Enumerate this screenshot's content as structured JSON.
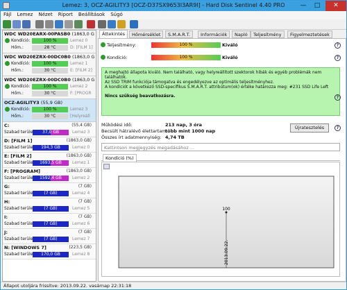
{
  "window": {
    "title": "Lemez: 3, OCZ-AGILITY3 [OCZ-D37SX9653I3AR9I] - Hard Disk Sentinel 4.40 PRO"
  },
  "menu": [
    "Fájl",
    "Lemez",
    "Nézet",
    "Riport",
    "Beállítások",
    "Súgó"
  ],
  "disks": [
    {
      "name": "WDC WD20EARX-00PASB0",
      "size": "(1863,0 GB)",
      "cond_label": "Kondíció:",
      "cond": "100 %",
      "cond_ext": "Lemez 0",
      "temp_label": "Hőm.:",
      "temp": "28 °C",
      "temp_ext": "D: [FILM 1]",
      "selected": false
    },
    {
      "name": "WDC WD20EZRX-00DC0B0",
      "size": "(1863,0 GB)",
      "cond_label": "Kondíció:",
      "cond": "100 %",
      "cond_ext": "Lemez 1",
      "temp_label": "Hőm.:",
      "temp": "30 °C",
      "temp_ext": "E: [FILM 2]",
      "selected": false
    },
    {
      "name": "WDC WD20EZRX-00DC0B0",
      "size": "(1863,0 GB)",
      "cond_label": "Kondíció:",
      "cond": "100 %",
      "cond_ext": "Lemez 2",
      "temp_label": "Hőm.:",
      "temp": "30 °C",
      "temp_ext": "F: [PROGR",
      "selected": false
    },
    {
      "name": "OCZ-AGILITY3",
      "size": "(55,9 GB)",
      "cond_label": "Kondíció:",
      "cond": "100 %",
      "cond_ext": "Lemez 3",
      "temp_label": "Hőm.:",
      "temp": "30 °C",
      "temp_ext": "[Helyreáll",
      "selected": true
    }
  ],
  "partitions": [
    {
      "name": "C:",
      "size": "(55,4 GB)",
      "free_label": "Szabad terület",
      "free": "37,0 GB",
      "disk": "Lemez 3",
      "mag": true
    },
    {
      "name": "D: [FILM 1]",
      "size": "(1863,0 GB)",
      "free_label": "Szabad terület",
      "free": "194,3 GB",
      "disk": "Lemez 0",
      "mag": false
    },
    {
      "name": "E: [FILM 2]",
      "size": "(1863,0 GB)",
      "free_label": "Szabad terület",
      "free": "1693,5 GB",
      "disk": "Lemez 1",
      "mag": true
    },
    {
      "name": "F: [PROGRAM]",
      "size": "(1863,0 GB)",
      "free_label": "Szabad terület",
      "free": "1592,4 GB",
      "disk": "Lemez 2",
      "mag": true
    },
    {
      "name": "G:",
      "size": "(7 GB)",
      "free_label": "Szabad terület",
      "free": "(7 GB)",
      "disk": "Lemez 4",
      "mag": false
    },
    {
      "name": "H:",
      "size": "(7 GB)",
      "free_label": "Szabad terület",
      "free": "(7 GB)",
      "disk": "Lemez 5",
      "mag": false
    },
    {
      "name": "I:",
      "size": "(7 GB)",
      "free_label": "Szabad terület",
      "free": "(7 GB)",
      "disk": "Lemez 6",
      "mag": false
    },
    {
      "name": "J:",
      "size": "(7 GB)",
      "free_label": "Szabad terület",
      "free": "(7 GB)",
      "disk": "Lemez 7",
      "mag": false
    },
    {
      "name": "N: [WINDOWS 7]",
      "size": "(223,5 GB)",
      "free_label": "Szabad terület",
      "free": "170,0 GB",
      "disk": "Lemez 8",
      "mag": false
    }
  ],
  "tabs": [
    "Áttekintés",
    "Hőmérséklet",
    "S.M.A.R.T.",
    "Információk",
    "Napló",
    "Teljesítmény",
    "Figyelmeztetések"
  ],
  "overview": {
    "perf_label": "Teljesítmény:",
    "perf_value": "100 %",
    "perf_text": "Kiváló",
    "cond_label": "Kondíció:",
    "cond_value": "100 %",
    "cond_text": "Kiváló",
    "message_1": "A meghajtó állapota kiváló. Nem található, vagy helyreállított szektorok hibák és egyéb problémák nem találhatók.",
    "message_2": "Az SSD TRIM funkciója támogatva és engedélyezve az optimális teljesítményhez.",
    "message_3": "A kondíciót a következő SSD-specifikus S.M.A.R.T. attribútum(ok) értéke határozza meg: #231 SSD Life Left",
    "message_4": "Nincs szükség beavatkozásra.",
    "uptime_label": "Működési idő:",
    "uptime_value": "213 nap, 3 óra",
    "remain_label": "Becsült hátralévő élettartam:",
    "remain_value": "több mint 1000 nap",
    "written_label": "Összes írt adatmennyiség:",
    "written_value": "4,74 TB",
    "repeat_btn": "Újratesztelés",
    "comment_placeholder": "Kattintson megjegyzés megadásához ...",
    "subtab": "Kondíció (%)"
  },
  "chart_data": {
    "type": "line",
    "x": [
      "2013.09.22."
    ],
    "values": [
      100
    ],
    "ylim": [
      0,
      100
    ]
  },
  "status": "Állapot utoljára frissítve: 2013.09.22. vasárnap 22:31:18"
}
